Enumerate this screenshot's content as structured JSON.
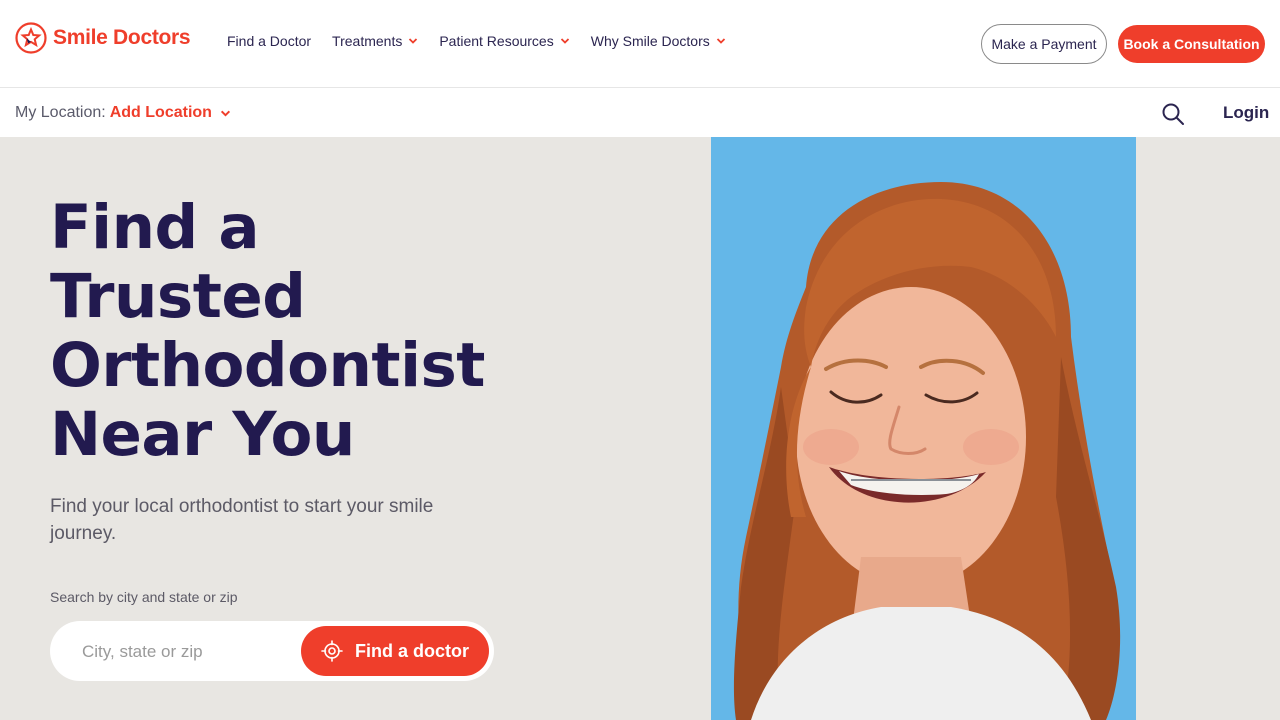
{
  "brand": {
    "name": "Smile Doctors",
    "color": "#ef3e2b",
    "navy": "#221a4f"
  },
  "nav": {
    "items": [
      {
        "label": "Find a Doctor",
        "has_dropdown": false
      },
      {
        "label": "Treatments",
        "has_dropdown": true
      },
      {
        "label": "Patient Resources",
        "has_dropdown": true
      },
      {
        "label": "Why Smile Doctors",
        "has_dropdown": true
      }
    ],
    "payment_button": "Make a Payment",
    "consult_button": "Book a Consultation"
  },
  "location": {
    "label": "My Location:",
    "value": "Add Location"
  },
  "topbar": {
    "search_icon": "search-icon",
    "login": "Login"
  },
  "hero": {
    "title_lines": [
      "Find a",
      "Trusted",
      "Orthodontist",
      "Near You"
    ],
    "subtitle": "Find your local orthodontist to start your smile journey.",
    "search_label": "Search by city and state or zip",
    "search_placeholder": "City, state or zip",
    "search_value": "",
    "find_button": "Find a doctor",
    "find_icon": "target-icon",
    "background": "#e8e6e2",
    "photo_background": "#64b7e8"
  }
}
